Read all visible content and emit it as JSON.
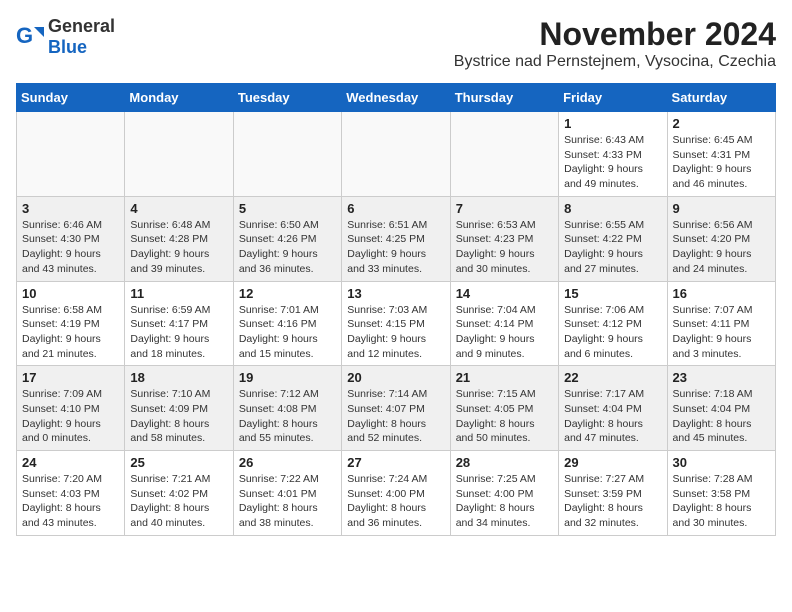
{
  "logo": {
    "general": "General",
    "blue": "Blue"
  },
  "title": "November 2024",
  "location": "Bystrice nad Pernstejnem, Vysocina, Czechia",
  "days_of_week": [
    "Sunday",
    "Monday",
    "Tuesday",
    "Wednesday",
    "Thursday",
    "Friday",
    "Saturday"
  ],
  "weeks": [
    [
      {
        "day": "",
        "info": "",
        "empty": true
      },
      {
        "day": "",
        "info": "",
        "empty": true
      },
      {
        "day": "",
        "info": "",
        "empty": true
      },
      {
        "day": "",
        "info": "",
        "empty": true
      },
      {
        "day": "",
        "info": "",
        "empty": true
      },
      {
        "day": "1",
        "info": "Sunrise: 6:43 AM\nSunset: 4:33 PM\nDaylight: 9 hours and 49 minutes."
      },
      {
        "day": "2",
        "info": "Sunrise: 6:45 AM\nSunset: 4:31 PM\nDaylight: 9 hours and 46 minutes."
      }
    ],
    [
      {
        "day": "3",
        "info": "Sunrise: 6:46 AM\nSunset: 4:30 PM\nDaylight: 9 hours and 43 minutes."
      },
      {
        "day": "4",
        "info": "Sunrise: 6:48 AM\nSunset: 4:28 PM\nDaylight: 9 hours and 39 minutes."
      },
      {
        "day": "5",
        "info": "Sunrise: 6:50 AM\nSunset: 4:26 PM\nDaylight: 9 hours and 36 minutes."
      },
      {
        "day": "6",
        "info": "Sunrise: 6:51 AM\nSunset: 4:25 PM\nDaylight: 9 hours and 33 minutes."
      },
      {
        "day": "7",
        "info": "Sunrise: 6:53 AM\nSunset: 4:23 PM\nDaylight: 9 hours and 30 minutes."
      },
      {
        "day": "8",
        "info": "Sunrise: 6:55 AM\nSunset: 4:22 PM\nDaylight: 9 hours and 27 minutes."
      },
      {
        "day": "9",
        "info": "Sunrise: 6:56 AM\nSunset: 4:20 PM\nDaylight: 9 hours and 24 minutes."
      }
    ],
    [
      {
        "day": "10",
        "info": "Sunrise: 6:58 AM\nSunset: 4:19 PM\nDaylight: 9 hours and 21 minutes."
      },
      {
        "day": "11",
        "info": "Sunrise: 6:59 AM\nSunset: 4:17 PM\nDaylight: 9 hours and 18 minutes."
      },
      {
        "day": "12",
        "info": "Sunrise: 7:01 AM\nSunset: 4:16 PM\nDaylight: 9 hours and 15 minutes."
      },
      {
        "day": "13",
        "info": "Sunrise: 7:03 AM\nSunset: 4:15 PM\nDaylight: 9 hours and 12 minutes."
      },
      {
        "day": "14",
        "info": "Sunrise: 7:04 AM\nSunset: 4:14 PM\nDaylight: 9 hours and 9 minutes."
      },
      {
        "day": "15",
        "info": "Sunrise: 7:06 AM\nSunset: 4:12 PM\nDaylight: 9 hours and 6 minutes."
      },
      {
        "day": "16",
        "info": "Sunrise: 7:07 AM\nSunset: 4:11 PM\nDaylight: 9 hours and 3 minutes."
      }
    ],
    [
      {
        "day": "17",
        "info": "Sunrise: 7:09 AM\nSunset: 4:10 PM\nDaylight: 9 hours and 0 minutes."
      },
      {
        "day": "18",
        "info": "Sunrise: 7:10 AM\nSunset: 4:09 PM\nDaylight: 8 hours and 58 minutes."
      },
      {
        "day": "19",
        "info": "Sunrise: 7:12 AM\nSunset: 4:08 PM\nDaylight: 8 hours and 55 minutes."
      },
      {
        "day": "20",
        "info": "Sunrise: 7:14 AM\nSunset: 4:07 PM\nDaylight: 8 hours and 52 minutes."
      },
      {
        "day": "21",
        "info": "Sunrise: 7:15 AM\nSunset: 4:05 PM\nDaylight: 8 hours and 50 minutes."
      },
      {
        "day": "22",
        "info": "Sunrise: 7:17 AM\nSunset: 4:04 PM\nDaylight: 8 hours and 47 minutes."
      },
      {
        "day": "23",
        "info": "Sunrise: 7:18 AM\nSunset: 4:04 PM\nDaylight: 8 hours and 45 minutes."
      }
    ],
    [
      {
        "day": "24",
        "info": "Sunrise: 7:20 AM\nSunset: 4:03 PM\nDaylight: 8 hours and 43 minutes."
      },
      {
        "day": "25",
        "info": "Sunrise: 7:21 AM\nSunset: 4:02 PM\nDaylight: 8 hours and 40 minutes."
      },
      {
        "day": "26",
        "info": "Sunrise: 7:22 AM\nSunset: 4:01 PM\nDaylight: 8 hours and 38 minutes."
      },
      {
        "day": "27",
        "info": "Sunrise: 7:24 AM\nSunset: 4:00 PM\nDaylight: 8 hours and 36 minutes."
      },
      {
        "day": "28",
        "info": "Sunrise: 7:25 AM\nSunset: 4:00 PM\nDaylight: 8 hours and 34 minutes."
      },
      {
        "day": "29",
        "info": "Sunrise: 7:27 AM\nSunset: 3:59 PM\nDaylight: 8 hours and 32 minutes."
      },
      {
        "day": "30",
        "info": "Sunrise: 7:28 AM\nSunset: 3:58 PM\nDaylight: 8 hours and 30 minutes."
      }
    ]
  ]
}
